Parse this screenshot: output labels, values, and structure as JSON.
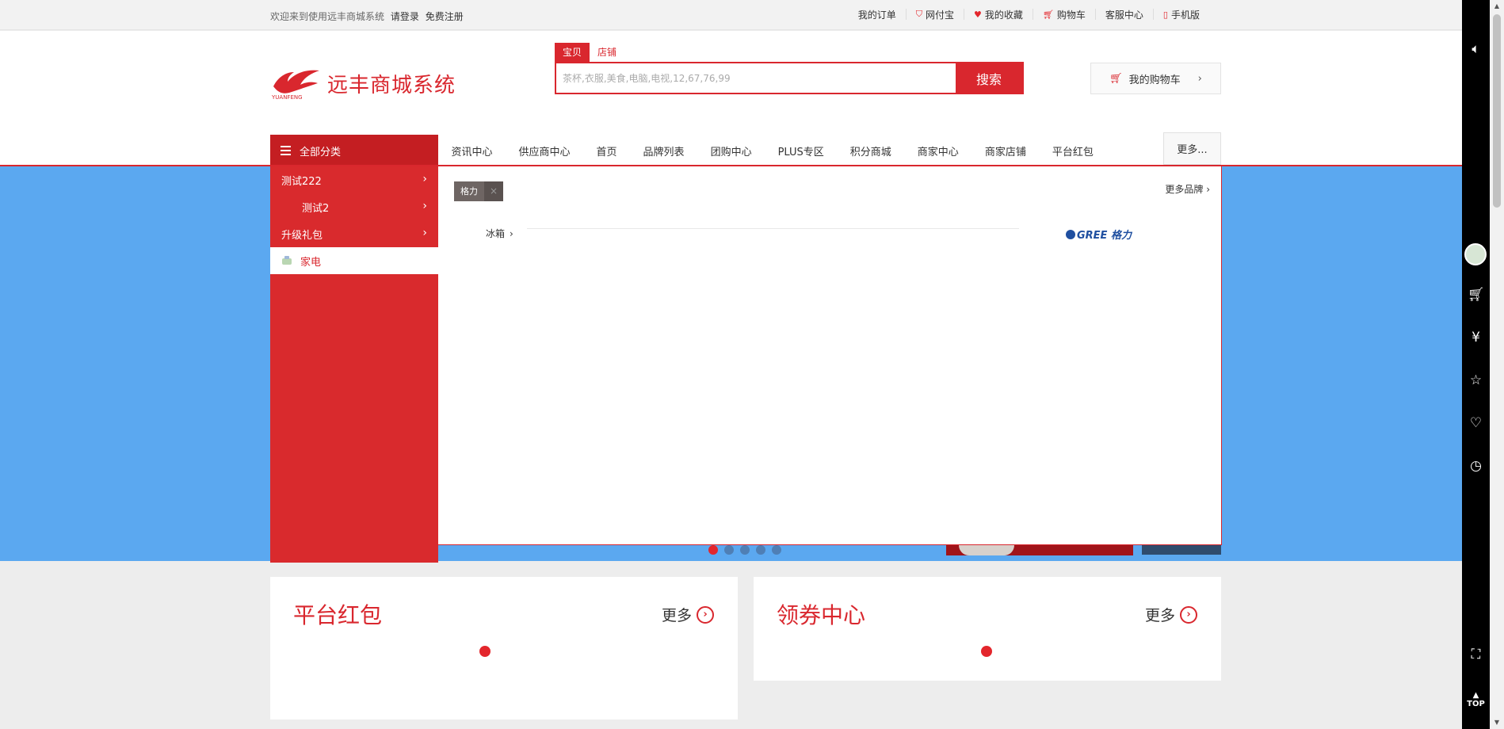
{
  "topbar": {
    "welcome": "欢迎来到使用远丰商城系统",
    "login": "请登录",
    "register": "免费注册",
    "links": [
      {
        "label": "我的订单",
        "icon": ""
      },
      {
        "label": "网付宝",
        "icon": "shield-icon"
      },
      {
        "label": "我的收藏",
        "icon": "heart-icon"
      },
      {
        "label": "购物车",
        "icon": "cart-icon"
      },
      {
        "label": "客服中心",
        "icon": ""
      },
      {
        "label": "手机版",
        "icon": "phone-icon"
      }
    ]
  },
  "logo": {
    "name": "远丰商城系统",
    "sub": "YUANFENG"
  },
  "search": {
    "tab_goods": "宝贝",
    "tab_shop": "店铺",
    "placeholder": "茶杯,衣服,美食,电脑,电视,12,67,76,99",
    "button": "搜索"
  },
  "cart_button": {
    "label": "我的购物车"
  },
  "nav": {
    "all_categories": "全部分类",
    "links": [
      "资讯中心",
      "供应商中心",
      "首页",
      "品牌列表",
      "团购中心",
      "PLUS专区",
      "积分商城",
      "商家中心",
      "商家店铺",
      "平台红包"
    ],
    "more": "更多..."
  },
  "sidebar": {
    "items": [
      {
        "label": "测试222"
      },
      {
        "label": "测试2"
      },
      {
        "label": "升级礼包"
      },
      {
        "label": "家电"
      }
    ]
  },
  "flyout": {
    "brand": "格力",
    "close": "×",
    "more_brands": "更多品牌",
    "sub_category": "冰箱",
    "brand_logo": "GREE 格力"
  },
  "cards": {
    "red_packet": {
      "title": "平台红包",
      "more": "更多"
    },
    "coupon": {
      "title": "领券中心",
      "more": "更多"
    }
  },
  "toolbar": {
    "top": "TOP"
  },
  "colors": {
    "brand": "#d9272e",
    "banner": "#5ba8f0"
  }
}
